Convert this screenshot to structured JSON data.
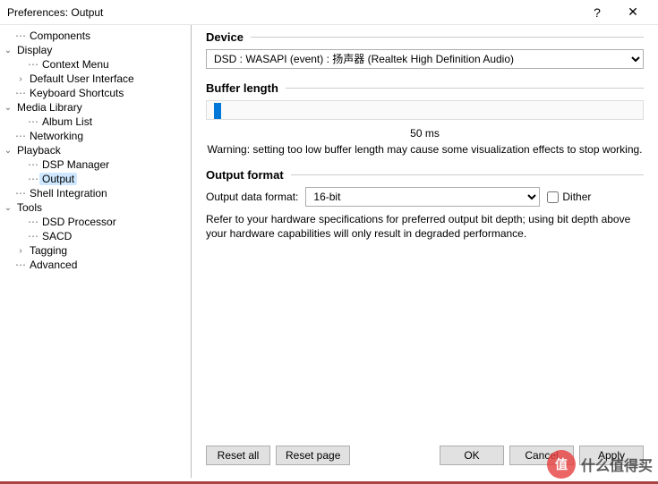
{
  "window": {
    "title": "Preferences: Output"
  },
  "tree": {
    "components": "Components",
    "display": "Display",
    "context_menu": "Context Menu",
    "default_ui": "Default User Interface",
    "kbd": "Keyboard Shortcuts",
    "media_library": "Media Library",
    "album_list": "Album List",
    "networking": "Networking",
    "playback": "Playback",
    "dsp_manager": "DSP Manager",
    "output": "Output",
    "shell": "Shell Integration",
    "tools": "Tools",
    "dsd_proc": "DSD Processor",
    "sacd": "SACD",
    "tagging": "Tagging",
    "advanced": "Advanced"
  },
  "device": {
    "heading": "Device",
    "selected": "DSD : WASAPI (event) : 扬声器 (Realtek High Definition Audio)"
  },
  "buffer": {
    "heading": "Buffer length",
    "value_text": "50 ms",
    "warning": "Warning: setting too low buffer length may cause some visualization effects to stop working."
  },
  "format": {
    "heading": "Output format",
    "label": "Output data format:",
    "selected": "16-bit",
    "dither_label": "Dither",
    "dither_checked": false,
    "help": "Refer to your hardware specifications for preferred output bit depth; using bit depth above your hardware capabilities will only result in degraded performance."
  },
  "buttons": {
    "reset_all": "Reset all",
    "reset_page": "Reset page",
    "ok": "OK",
    "cancel": "Cancel",
    "apply": "Apply"
  },
  "watermark": {
    "badge": "值",
    "text": "什么值得买"
  }
}
